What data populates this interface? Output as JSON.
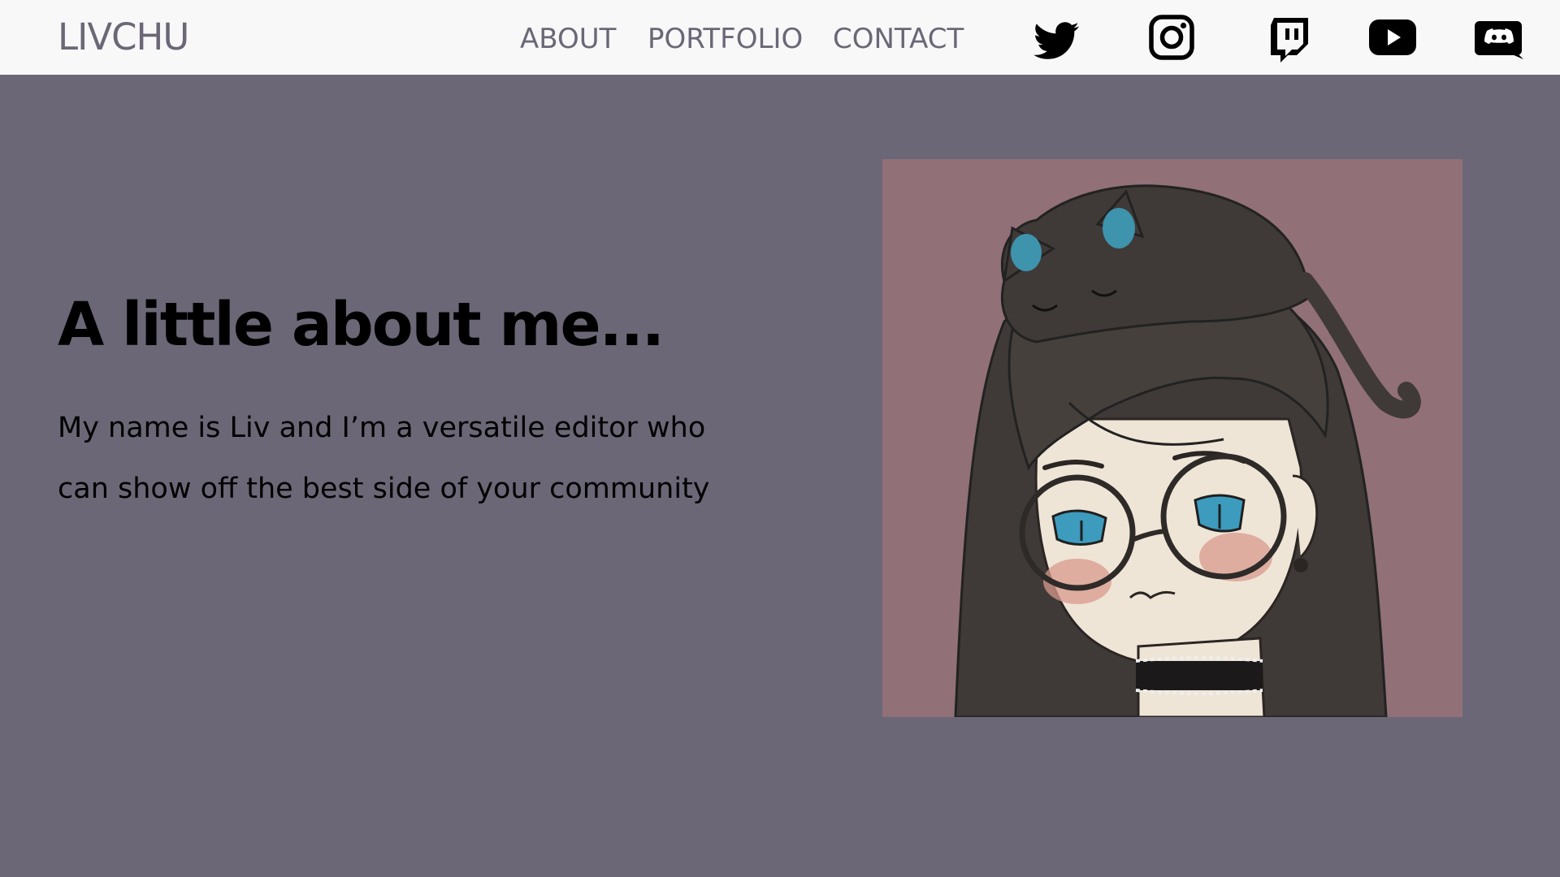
{
  "nav": {
    "brand": "LIVCHU",
    "links": [
      {
        "label": "ABOUT"
      },
      {
        "label": "PORTFOLIO"
      },
      {
        "label": "CONTACT"
      }
    ],
    "social_icons": [
      "twitter-icon",
      "instagram-icon",
      "twitch-icon",
      "youtube-icon",
      "discord-icon"
    ]
  },
  "about": {
    "title": "A little about me...",
    "text": "My name is Liv and I’m a versatile editor who can show off the best side of your community"
  },
  "colors": {
    "background": "#6b6776",
    "navbar": "#f8f8f9",
    "nav_text": "#6b6776",
    "portrait_background": "#917077",
    "heading_text": "#000000"
  }
}
